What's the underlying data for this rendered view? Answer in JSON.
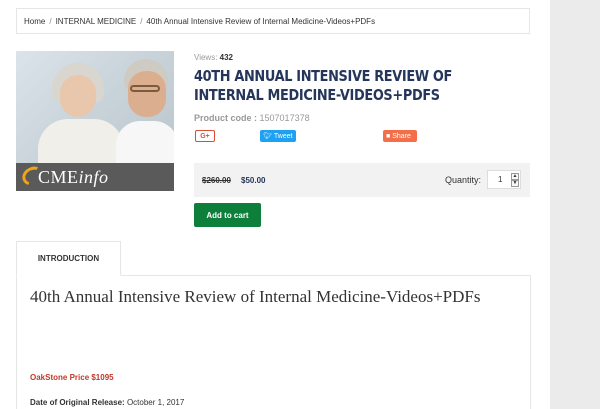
{
  "breadcrumb": {
    "items": [
      "Home",
      "INTERNAL MEDICINE",
      "40th Annual Intensive Review of Internal Medicine-Videos+PDFs"
    ]
  },
  "product": {
    "image_logo": "CMEinfo",
    "views_label": "Views:",
    "views_count": "432",
    "title": "40TH ANNUAL INTENSIVE REVIEW OF INTERNAL MEDICINE-VIDEOS+PDFS",
    "code_label": "Product code :",
    "code_value": "1507017378"
  },
  "social": {
    "gplus_label": "G+",
    "tweet_label": "Tweet",
    "share_label": "Share"
  },
  "pricing": {
    "old_price": "$260.00",
    "new_price": "$50.00",
    "quantity_label": "Quantity:",
    "quantity_value": "1"
  },
  "actions": {
    "add_to_cart": "Add to cart"
  },
  "tabs": {
    "introduction": "INTRODUCTION"
  },
  "description": {
    "title": "40th Annual Intensive Review of Internal Medicine-Videos+PDFs",
    "oakstone_price": "OakStone Price $1095",
    "release_label": "Date of Original Release:",
    "release_value": "October 1, 2017"
  },
  "colors": {
    "title": "#25365a",
    "add_to_cart": "#0d7f3a",
    "tweet": "#1da1f2",
    "share": "#f36f4a",
    "gplus": "#dd4b39",
    "oakstone_price": "#c0392b"
  },
  "icons": {
    "tweet": "twitter-bird-icon",
    "share": "share-icon",
    "qty_up": "caret-up-icon",
    "qty_down": "caret-down-icon"
  }
}
